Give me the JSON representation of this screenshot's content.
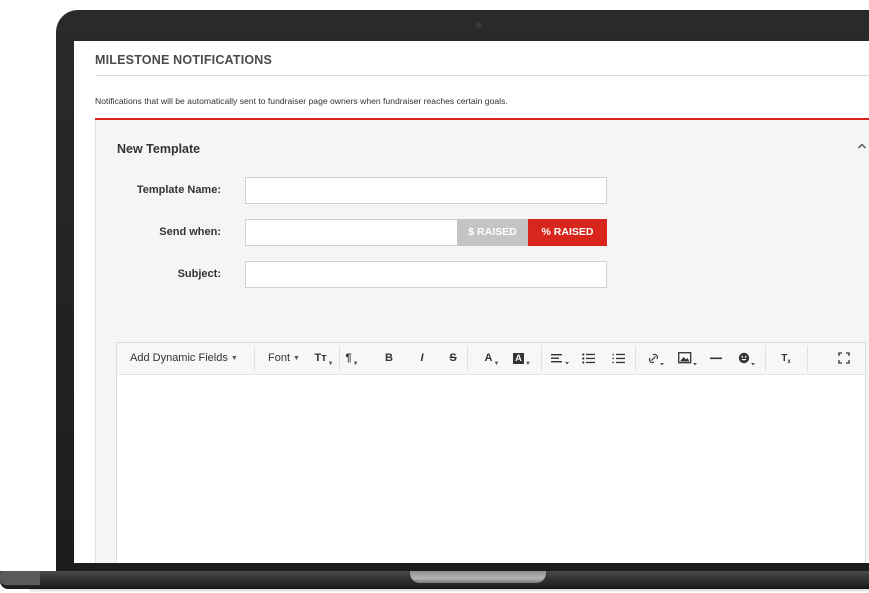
{
  "milestone": {
    "section_title": "MILESTONE NOTIFICATIONS",
    "description": "Notifications that will be automatically sent to fundraiser page owners when fundraiser reaches certain goals."
  },
  "template_panel": {
    "title": "New Template",
    "collapse_icon": "chevron-up-icon",
    "fields": {
      "template_name": {
        "label": "Template Name:",
        "value": ""
      },
      "send_when": {
        "label": "Send when:",
        "value": ""
      },
      "subject": {
        "label": "Subject:",
        "value": ""
      }
    },
    "send_when_toggle": {
      "dollar_raised_label": "$ RAISED",
      "percent_raised_label": "% RAISED",
      "selected": "percent_raised"
    }
  },
  "editor": {
    "toolbar": {
      "dynamic_fields_label": "Add Dynamic Fields",
      "font_label": "Font",
      "font_size_icon": "Tт",
      "paragraph_icon": "¶",
      "bold_icon": "B",
      "italic_icon": "I",
      "strikethrough_icon": "S",
      "text_color_icon": "A",
      "bg_color_icon": "A",
      "align_icon": "align-left-icon",
      "bulleted_list_icon": "bulleted-list-icon",
      "numbered_list_icon": "numbered-list-icon",
      "link_icon": "link-icon",
      "image_icon": "image-icon",
      "horizontal_rule_icon": "horizontal-rule-icon",
      "emoji_icon": "emoji-icon",
      "clear_format_icon": "Tx",
      "fullscreen_icon": "fullscreen-icon"
    },
    "content": ""
  },
  "colors": {
    "accent_red": "#d9261c",
    "inactive_gray": "#c4c4c4",
    "bezel": "#1c1c1c"
  }
}
